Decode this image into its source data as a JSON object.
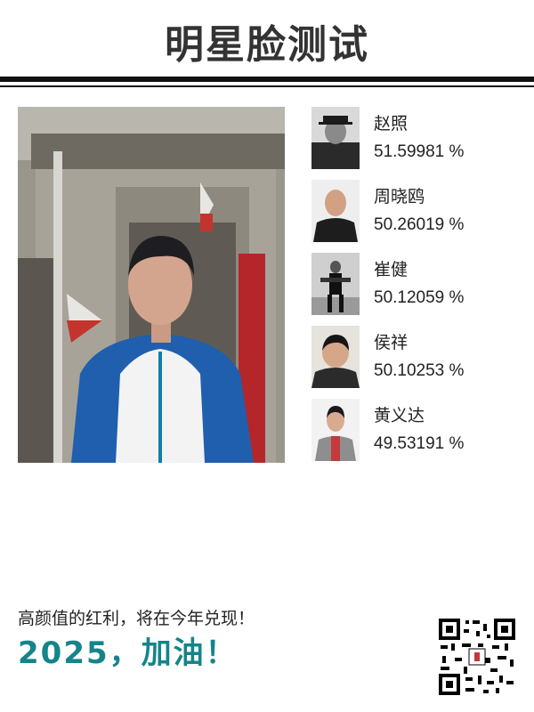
{
  "header": {
    "title": "明星脸测试"
  },
  "photo": {
    "label": "user-photo"
  },
  "matches": [
    {
      "name": "赵照",
      "score": "51.59981 %"
    },
    {
      "name": "周晓鸥",
      "score": "50.26019 %"
    },
    {
      "name": "崔健",
      "score": "50.12059 %"
    },
    {
      "name": "侯祥",
      "score": "50.10253 %"
    },
    {
      "name": "黄义达",
      "score": "49.53191 %"
    }
  ],
  "footer": {
    "slogan": "高颜值的红利，将在今年兑现！",
    "cheer": "2025，加油！"
  },
  "colors": {
    "accent": "#14858a",
    "rule": "#111111"
  }
}
